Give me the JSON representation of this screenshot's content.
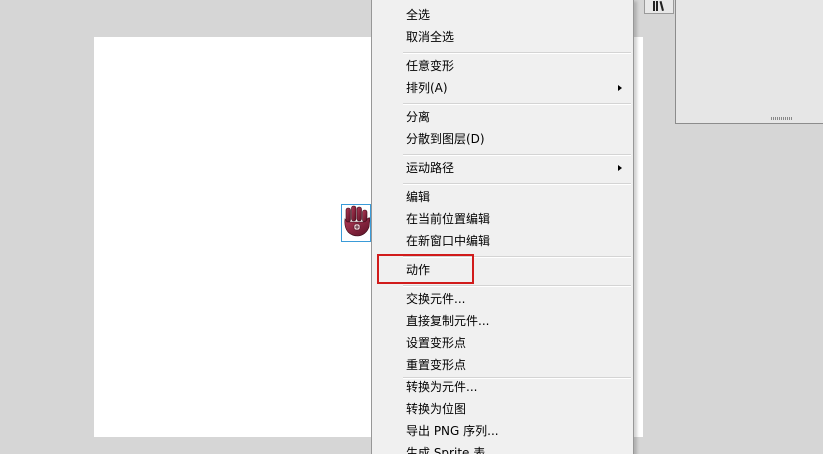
{
  "context_menu": {
    "items": [
      {
        "label": "全选",
        "has_submenu": false
      },
      {
        "label": "取消全选",
        "has_submenu": false
      },
      {
        "label": "任意变形",
        "has_submenu": false
      },
      {
        "label": "排列(A)",
        "has_submenu": true
      },
      {
        "label": "分离",
        "has_submenu": false
      },
      {
        "label": "分散到图层(D)",
        "has_submenu": false
      },
      {
        "label": "运动路径",
        "has_submenu": true
      },
      {
        "label": "编辑",
        "has_submenu": false
      },
      {
        "label": "在当前位置编辑",
        "has_submenu": false
      },
      {
        "label": "在新窗口中编辑",
        "has_submenu": false
      },
      {
        "label": "动作",
        "has_submenu": false,
        "highlighted": true
      },
      {
        "label": "交换元件...",
        "has_submenu": false
      },
      {
        "label": "直接复制元件...",
        "has_submenu": false
      },
      {
        "label": "设置变形点",
        "has_submenu": false
      },
      {
        "label": "重置变形点",
        "has_submenu": false
      },
      {
        "label": "转换为元件...",
        "has_submenu": false
      },
      {
        "label": "转换为位图",
        "has_submenu": false
      },
      {
        "label": "导出 PNG 序列...",
        "has_submenu": false
      },
      {
        "label": "生成 Sprite 表...",
        "has_submenu": false
      }
    ]
  },
  "symbol": {
    "icon": "hand-icon"
  },
  "colors": {
    "highlight_border": "#d11b1b",
    "selection_border": "#3a9bd8",
    "menu_background": "#f0f0f0",
    "workspace_background": "#d6d6d6"
  }
}
